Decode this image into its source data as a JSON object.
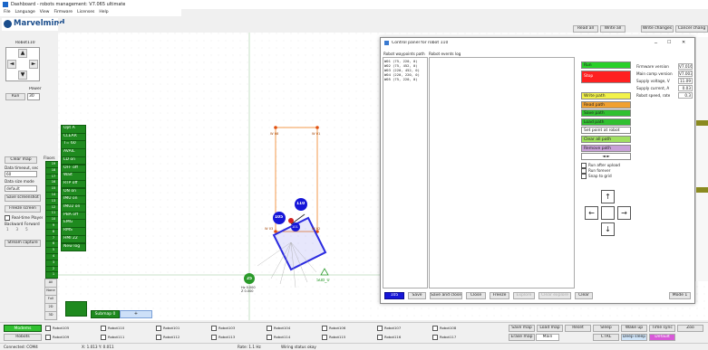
{
  "window": {
    "title": "Dashboard - robots management: V7.065  ultimate"
  },
  "menu": [
    "File",
    "Language",
    "View",
    "Firmware",
    "Licenses",
    "Help"
  ],
  "brand": {
    "name": "Marvelmind"
  },
  "top_right_buttons": [
    "Read all",
    "Write all",
    "Write changes",
    "Cancel chang"
  ],
  "left_panel": {
    "robot_label": "Robot110",
    "power_label": "Power",
    "run_label": "Run",
    "run_value": "30",
    "clear_map": "Clear map",
    "data_timeout_label": "Data timeout, sec",
    "data_timeout_value": "60",
    "data_size_mode_label": "Data size mode",
    "data_size_mode_value": "default",
    "save_screenshot": "Save screenshot",
    "freeze_screen": "Freeze screen",
    "realtime_player": "Real-time Player",
    "backward_forward": "Backward Forward",
    "stream_capture": "Stream capture",
    "player_nums": [
      "1",
      "3",
      "5"
    ]
  },
  "green_buttons": [
    "Opt A",
    "CLEAR",
    "T= 60",
    "AVAIL",
    "LD on",
    "OFF off",
    "Wait",
    "RTP off",
    "ON on",
    "IMU on",
    "IMU2 on",
    "PBA off",
    "EMG",
    "RMS",
    "HMI 22",
    "New log"
  ],
  "floor_label": "Floors",
  "floor_numbers": [
    "19",
    "18",
    "17",
    "16",
    "15",
    "14",
    "13",
    "12",
    "11",
    "10",
    "9",
    "8",
    "7",
    "6",
    "5",
    "4",
    "3",
    "2",
    "1"
  ],
  "map_controls": [
    "All",
    "None",
    "Full",
    "2D",
    "3D"
  ],
  "submap": {
    "label": "Submap 0",
    "plus": "+"
  },
  "map": {
    "beacon_labels": [
      "W 08",
      "W 01",
      "W 03",
      "W 02"
    ],
    "hedge_ids": [
      "105",
      "110",
      "101"
    ],
    "anchor_id": "25",
    "anchor_caption": "Hz 0.000\nZ 0.000",
    "sub_label": "Sub_0"
  },
  "control_panel": {
    "title": "Control panel for robot 110",
    "col_waypoints": "Robot waypoints path",
    "col_events": "Robot events log",
    "waypoints": [
      "W01 (75, 220, 0)",
      "W02 (75, 452, 0)",
      "W03 (220, 452, 0)",
      "W04 (220, 220, 0)",
      "W05 (75, 220, 0)"
    ],
    "run_btn": "Run",
    "stop_btn": "Stop",
    "path_buttons": [
      {
        "label": "Write path",
        "color": "#f2f24a"
      },
      {
        "label": "Read path",
        "color": "#f0a030"
      },
      {
        "label": "Save path",
        "color": "#30c030"
      },
      {
        "label": "Load path",
        "color": "#30c030"
      },
      {
        "label": "Set point at robot",
        "color": "#ffffff"
      },
      {
        "label": "Clear all path",
        "color": "#a0e060"
      },
      {
        "label": "Remove path",
        "color": "#c8a0d8"
      }
    ],
    "checkboxes": [
      "Run after upload",
      "Run forever",
      "Snap to grid"
    ],
    "params": [
      {
        "label": "Firmware version",
        "value": "V7.016"
      },
      {
        "label": "Main comp version",
        "value": "V7.003"
      },
      {
        "label": "Supply voltage, V",
        "value": "11.09"
      },
      {
        "label": "Supply current, A",
        "value": "0.03"
      },
      {
        "label": "Robot speed, rate",
        "value": "0.3"
      }
    ],
    "bottom_buttons": [
      "105",
      "Save",
      "Save and close",
      "Close",
      "Freeze",
      "Explore",
      "Clear explore",
      "Clear",
      "Mode 1"
    ]
  },
  "bottom_bar": {
    "modems": "Modems",
    "robots": "Robots",
    "robot_items": [
      "Robot105",
      "Robot110",
      "Robot101",
      "Robot103",
      "Robot104",
      "Robot106",
      "Robot107",
      "Robot108",
      "Robot109",
      "Robot111",
      "Robot112",
      "Robot113",
      "Robot114",
      "Robot115",
      "Robot116",
      "Robot117"
    ],
    "right_buttons_row1": [
      "Save map",
      "Load map",
      "Reset",
      "Sleep",
      "Wake up",
      "Time sync",
      "Zoo"
    ],
    "right_buttons_row2": [
      "Erase map",
      "CTRL",
      "Deep sleep",
      "Default"
    ],
    "dropdown_value": "Main"
  },
  "status_bar": {
    "connected": "Connected: COM4",
    "coords": "X: 1.013  Y: 0.011",
    "rate": "Rate: 1.1 Hz",
    "msg": "Wiring status okay"
  }
}
